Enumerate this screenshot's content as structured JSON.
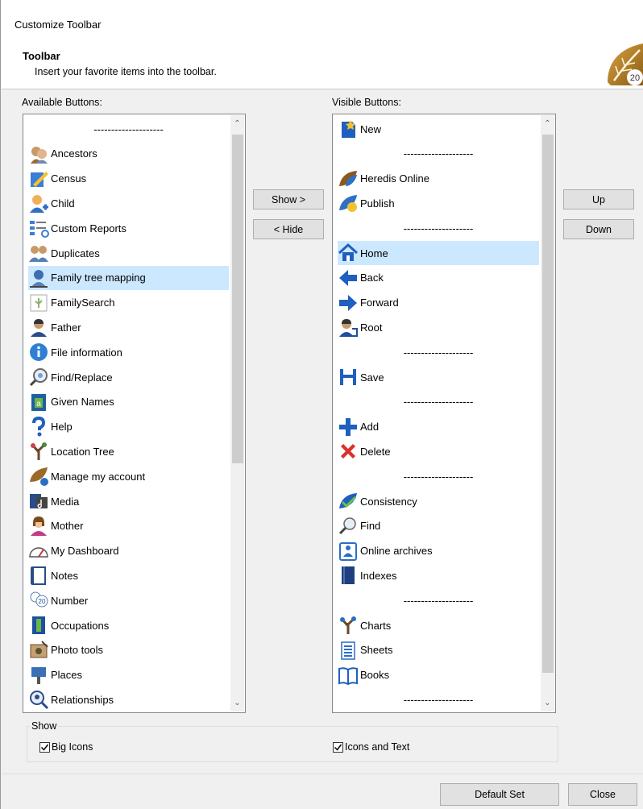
{
  "window": {
    "title": "Customize Toolbar"
  },
  "header": {
    "title": "Toolbar",
    "subtitle": "Insert your favorite items into the toolbar.",
    "logo_text": "20"
  },
  "available": {
    "label": "Available Buttons:",
    "items": [
      {
        "label": "--------------------",
        "icon": "separator",
        "sep": true
      },
      {
        "label": "Ancestors",
        "icon": "ancestors-icon"
      },
      {
        "label": "Census",
        "icon": "census-icon"
      },
      {
        "label": "Child",
        "icon": "child-icon"
      },
      {
        "label": "Custom Reports",
        "icon": "custom-reports-icon"
      },
      {
        "label": "Duplicates",
        "icon": "duplicates-icon"
      },
      {
        "label": "Family tree mapping",
        "icon": "family-tree-mapping-icon",
        "selected": true
      },
      {
        "label": "FamilySearch",
        "icon": "familysearch-icon"
      },
      {
        "label": "Father",
        "icon": "father-icon"
      },
      {
        "label": "File information",
        "icon": "file-information-icon"
      },
      {
        "label": "Find/Replace",
        "icon": "find-replace-icon"
      },
      {
        "label": "Given Names",
        "icon": "given-names-icon"
      },
      {
        "label": "Help",
        "icon": "help-icon"
      },
      {
        "label": "Location Tree",
        "icon": "location-tree-icon"
      },
      {
        "label": "Manage my account",
        "icon": "manage-account-icon"
      },
      {
        "label": "Media",
        "icon": "media-icon"
      },
      {
        "label": "Mother",
        "icon": "mother-icon"
      },
      {
        "label": "My Dashboard",
        "icon": "dashboard-icon"
      },
      {
        "label": "Notes",
        "icon": "notes-icon"
      },
      {
        "label": "Number",
        "icon": "number-icon"
      },
      {
        "label": "Occupations",
        "icon": "occupations-icon"
      },
      {
        "label": "Photo tools",
        "icon": "photo-tools-icon"
      },
      {
        "label": "Places",
        "icon": "places-icon"
      },
      {
        "label": "Relationships",
        "icon": "relationships-icon"
      }
    ]
  },
  "visible": {
    "label": "Visible Buttons:",
    "items": [
      {
        "label": "New",
        "icon": "new-icon"
      },
      {
        "label": "--------------------",
        "icon": "separator",
        "sep": true
      },
      {
        "label": "Heredis Online",
        "icon": "heredis-online-icon"
      },
      {
        "label": "Publish",
        "icon": "publish-icon"
      },
      {
        "label": "--------------------",
        "icon": "separator",
        "sep": true
      },
      {
        "label": "Home",
        "icon": "home-icon",
        "selected": true
      },
      {
        "label": "Back",
        "icon": "back-icon"
      },
      {
        "label": "Forward",
        "icon": "forward-icon"
      },
      {
        "label": "Root",
        "icon": "root-icon"
      },
      {
        "label": "--------------------",
        "icon": "separator",
        "sep": true
      },
      {
        "label": "Save",
        "icon": "save-icon"
      },
      {
        "label": "--------------------",
        "icon": "separator",
        "sep": true
      },
      {
        "label": "Add",
        "icon": "add-icon"
      },
      {
        "label": "Delete",
        "icon": "delete-icon"
      },
      {
        "label": "--------------------",
        "icon": "separator",
        "sep": true
      },
      {
        "label": "Consistency",
        "icon": "consistency-icon"
      },
      {
        "label": "Find",
        "icon": "find-icon"
      },
      {
        "label": "Online archives",
        "icon": "online-archives-icon"
      },
      {
        "label": "Indexes",
        "icon": "indexes-icon"
      },
      {
        "label": "--------------------",
        "icon": "separator",
        "sep": true
      },
      {
        "label": "Charts",
        "icon": "charts-icon"
      },
      {
        "label": "Sheets",
        "icon": "sheets-icon"
      },
      {
        "label": "Books",
        "icon": "books-icon"
      },
      {
        "label": "--------------------",
        "icon": "separator",
        "sep": true
      }
    ]
  },
  "buttons": {
    "show": "Show >",
    "hide": "< Hide",
    "up": "Up",
    "down": "Down",
    "default_set": "Default Set",
    "close": "Close"
  },
  "show_group": {
    "title": "Show",
    "big_icons": "Big Icons",
    "big_icons_checked": true,
    "icons_and_text": "Icons and Text",
    "icons_and_text_checked": true
  },
  "colors": {
    "selection": "#cce8ff",
    "button": "#e1e1e1",
    "dialog_bg": "#f0f0f0"
  }
}
